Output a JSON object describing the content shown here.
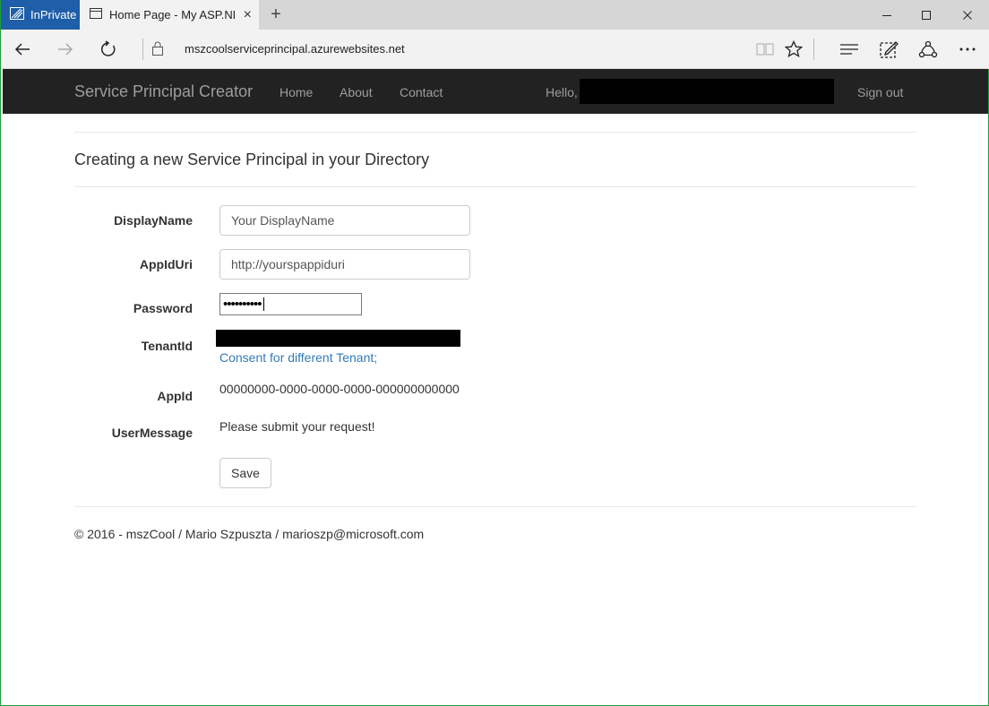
{
  "browser": {
    "inprivate_label": "InPrivate",
    "tab_title": "Home Page - My ASP.NE",
    "new_tab_symbol": "+",
    "tab_close_symbol": "×",
    "url": "mszcoolserviceprincipal.azurewebsites.net",
    "icons": [
      "inprivate-icon",
      "page-icon",
      "back-icon",
      "forward-icon",
      "refresh-icon",
      "lock-icon",
      "reading-view-icon",
      "favorite-star-icon",
      "hub-icon",
      "web-note-icon",
      "share-icon",
      "more-icon",
      "minimize-icon",
      "maximize-icon",
      "close-icon"
    ]
  },
  "site": {
    "brand": "Service Principal Creator",
    "nav": {
      "home": "Home",
      "about": "About",
      "contact": "Contact"
    },
    "hello": "Hello,",
    "signout": "Sign out"
  },
  "page": {
    "heading": "Creating a new Service Principal in your Directory"
  },
  "form": {
    "displayname_label": "DisplayName",
    "displayname_value": "Your DisplayName",
    "appiduri_label": "AppIdUri",
    "appiduri_value": "http://yourspappiduri",
    "password_label": "Password",
    "password_value": "••••••••••",
    "tenantid_label": "TenantId",
    "consent_link": "Consent for different Tenant;",
    "appid_label": "AppId",
    "appid_value": "00000000-0000-0000-0000-000000000000",
    "usermessage_label": "UserMessage",
    "usermessage_value": "Please submit your request!",
    "save_label": "Save"
  },
  "footer": {
    "text": "© 2016 - mszCool / Mario Szpuszta / marioszp@microsoft.com"
  },
  "colors": {
    "inprivate_bg": "#1f5ea8",
    "navbar_bg": "#222222",
    "link": "#337ab7",
    "window_border": "#1e9e3a"
  }
}
